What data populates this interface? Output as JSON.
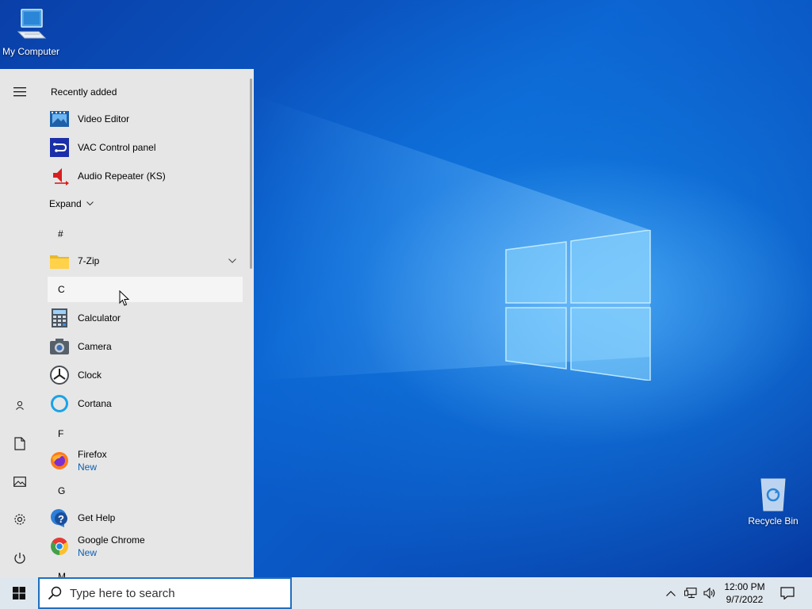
{
  "desktop": {
    "icons": [
      {
        "label": "My Computer",
        "icon": "computer-icon"
      },
      {
        "label": "Recycle Bin",
        "icon": "recycle-bin-icon"
      }
    ]
  },
  "start_menu": {
    "recently_added_title": "Recently added",
    "recent_apps": [
      {
        "name": "Video Editor",
        "icon": "video-editor-icon"
      },
      {
        "name": "VAC Control panel",
        "icon": "vac-control-panel-icon"
      },
      {
        "name": "Audio Repeater (KS)",
        "icon": "audio-repeater-icon"
      }
    ],
    "expand_label": "Expand",
    "groups": {
      "hash": "#",
      "c": "C",
      "f": "F",
      "g": "G",
      "m": "M"
    },
    "apps": {
      "seven_zip": "7-Zip",
      "calculator": "Calculator",
      "camera": "Camera",
      "clock": "Clock",
      "cortana": "Cortana",
      "firefox": "Firefox",
      "firefox_badge": "New",
      "get_help": "Get Help",
      "chrome": "Google Chrome",
      "chrome_badge": "New"
    },
    "rail_icons": [
      "hamburger-icon",
      "user-icon",
      "document-icon",
      "pictures-icon",
      "settings-icon",
      "power-icon"
    ]
  },
  "taskbar": {
    "search_placeholder": "Type here to search",
    "time": "12:00 PM",
    "date": "9/7/2022",
    "accent": "#1f6fc1"
  }
}
